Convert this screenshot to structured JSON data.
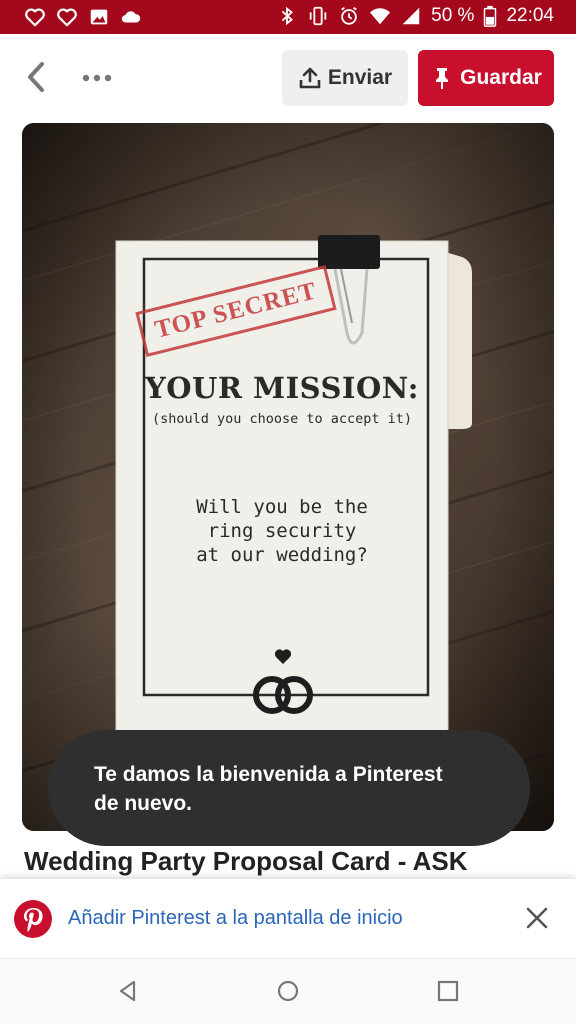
{
  "status_bar": {
    "battery_text": "50 %",
    "time": "22:04",
    "left_icons": [
      "heart-outline-icon",
      "heart-outline-icon",
      "image-icon",
      "cloud-icon"
    ],
    "right_icons": [
      "bluetooth-icon",
      "vibrate-icon",
      "alarm-icon",
      "wifi-icon",
      "signal-icon",
      "battery-icon"
    ],
    "background_color": "#a3081c"
  },
  "topbar": {
    "send_label": "Enviar",
    "save_label": "Guardar",
    "save_color": "#c8102e"
  },
  "pin": {
    "stamp_text": "TOP SECRET",
    "mission_title": "YOUR MISSION:",
    "mission_subtitle": "(should you choose to accept it)",
    "question_line1": "Will you be the",
    "question_line2": "ring security",
    "question_line3": "at our wedding?",
    "title": "Wedding Party Proposal Card - ASK"
  },
  "toast": {
    "line1": "Te damos la bienvenida a Pinterest",
    "line2": "de nuevo."
  },
  "banner": {
    "text": "Añadir Pinterest a la pantalla de inicio",
    "text_color": "#2b66b8"
  },
  "navbar": {
    "icons": [
      "back-triangle-icon",
      "home-circle-icon",
      "recents-square-icon"
    ]
  }
}
